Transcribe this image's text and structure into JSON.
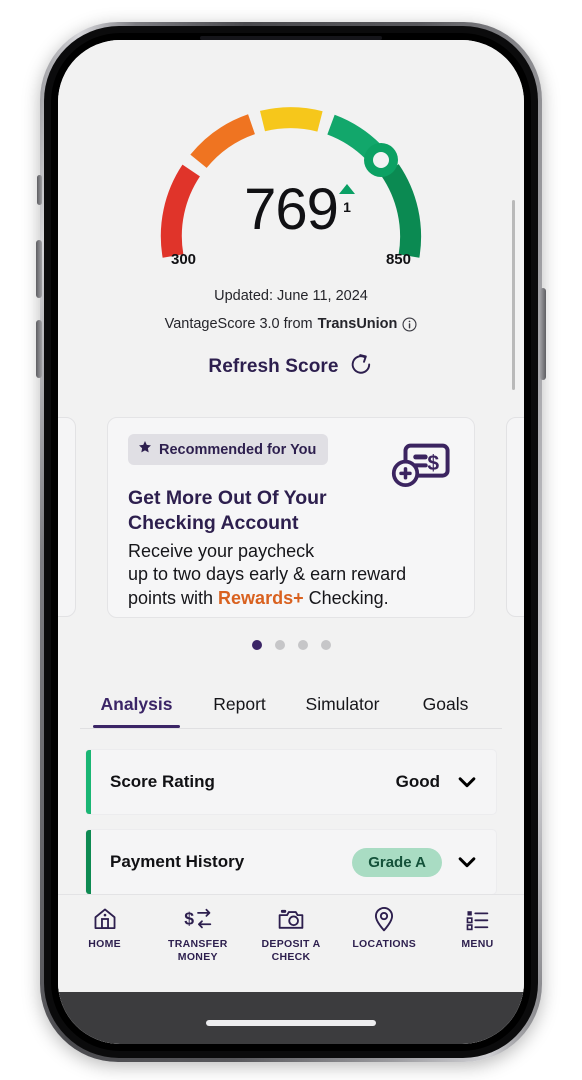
{
  "score_gauge": {
    "value": "769",
    "delta_direction": "up",
    "delta_value": "1",
    "min_label": "300",
    "max_label": "850",
    "segments": [
      {
        "name": "red",
        "color": "#e0342a"
      },
      {
        "name": "orange",
        "color": "#ef7421"
      },
      {
        "name": "yellow",
        "color": "#f6c71b"
      },
      {
        "name": "light-green",
        "color": "#12a76b"
      },
      {
        "name": "dark-green",
        "color": "#0b8a52"
      }
    ],
    "marker_color": "#0ca163",
    "updated_text": "Updated: June 11, 2024",
    "bureau_prefix": "VantageScore 3.0 from ",
    "bureau_name": "TransUnion",
    "info_icon": "info-circle-icon",
    "refresh_label": "Refresh Score",
    "refresh_icon": "refresh-circular-arrow-icon"
  },
  "carousel": {
    "badge_icon": "star-icon",
    "badge_label": "Recommended for You",
    "promo_icon": "check-deposit-icon",
    "title_line1": "Get More Out Of Your",
    "title_line2": "Checking Account",
    "body_line1": "Receive your paycheck",
    "body_line2": "up to two days early & earn reward",
    "body_line3_pre": "points with ",
    "body_line3_highlight": "Rewards+",
    "body_line3_post": " Checking.",
    "highlight_color": "#d9611f",
    "dots_total": 4,
    "active_dot_index": 0
  },
  "tabs": [
    {
      "label": "Analysis",
      "active": true
    },
    {
      "label": "Report",
      "active": false
    },
    {
      "label": "Simulator",
      "active": false
    },
    {
      "label": "Goals",
      "active": false
    }
  ],
  "accordion_rows": [
    {
      "title": "Score Rating",
      "value": "Good",
      "value_type": "text",
      "accent_color": "#1ab674",
      "chevron_icon": "chevron-down-icon"
    },
    {
      "title": "Payment History",
      "value": "Grade A",
      "value_type": "pill",
      "accent_color": "#0e8a52",
      "chevron_icon": "chevron-down-icon"
    }
  ],
  "bottom_nav": [
    {
      "label": "HOME",
      "icon": "home-icon"
    },
    {
      "label": "TRANSFER\nMONEY",
      "icon": "transfer-money-icon"
    },
    {
      "label": "DEPOSIT A\nCHECK",
      "icon": "camera-check-icon"
    },
    {
      "label": "LOCATIONS",
      "icon": "location-pin-icon"
    },
    {
      "label": "MENU",
      "icon": "menu-list-icon"
    }
  ],
  "theme": {
    "brand_purple": "#3b2566",
    "screen_bg": "#f2f2f2",
    "card_bg": "#f6f6f7"
  }
}
